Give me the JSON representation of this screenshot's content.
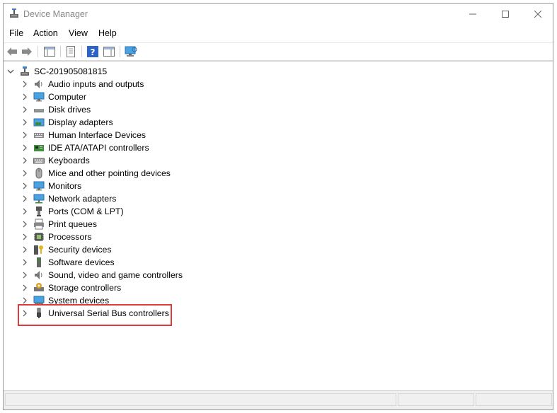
{
  "window": {
    "title": "Device Manager",
    "minimize_label": "Minimize",
    "maximize_label": "Maximize",
    "close_label": "Close"
  },
  "menu": [
    "File",
    "Action",
    "View",
    "Help"
  ],
  "tree": {
    "root": "SC-201905081815",
    "items": [
      {
        "label": "Audio inputs and outputs",
        "icon": "speaker-icon"
      },
      {
        "label": "Computer",
        "icon": "monitor-icon"
      },
      {
        "label": "Disk drives",
        "icon": "disk-drive-icon"
      },
      {
        "label": "Display adapters",
        "icon": "display-adapter-icon"
      },
      {
        "label": "Human Interface Devices",
        "icon": "hid-icon"
      },
      {
        "label": "IDE ATA/ATAPI controllers",
        "icon": "ide-controller-icon"
      },
      {
        "label": "Keyboards",
        "icon": "keyboard-icon"
      },
      {
        "label": "Mice and other pointing devices",
        "icon": "mouse-icon"
      },
      {
        "label": "Monitors",
        "icon": "monitor-icon"
      },
      {
        "label": "Network adapters",
        "icon": "network-adapter-icon"
      },
      {
        "label": "Ports (COM & LPT)",
        "icon": "port-icon"
      },
      {
        "label": "Print queues",
        "icon": "printer-icon"
      },
      {
        "label": "Processors",
        "icon": "processor-icon"
      },
      {
        "label": "Security devices",
        "icon": "security-key-icon"
      },
      {
        "label": "Software devices",
        "icon": "software-device-icon"
      },
      {
        "label": "Sound, video and game controllers",
        "icon": "speaker-icon"
      },
      {
        "label": "Storage controllers",
        "icon": "storage-controller-icon"
      },
      {
        "label": "System devices",
        "icon": "system-device-icon"
      },
      {
        "label": "Universal Serial Bus controllers",
        "icon": "usb-icon"
      }
    ]
  },
  "colors": {
    "highlight": "#e03a3a",
    "icon_blue": "#2b7bd6"
  }
}
